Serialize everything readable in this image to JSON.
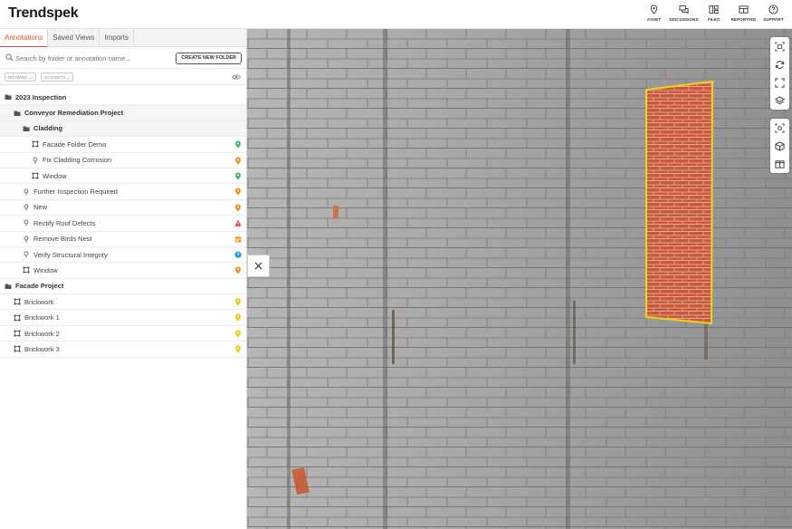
{
  "app": {
    "logo": "Trendspek"
  },
  "nav": [
    {
      "label": "ASSET",
      "icon": "map-pin-icon"
    },
    {
      "label": "DISCUSSIONS",
      "icon": "chat-icon"
    },
    {
      "label": "FILES",
      "icon": "files-icon"
    },
    {
      "label": "REPORTING",
      "icon": "report-icon"
    },
    {
      "label": "SUPPORT",
      "icon": "help-icon"
    }
  ],
  "tabs": [
    "Annotations",
    "Saved Views",
    "Imports"
  ],
  "search": {
    "placeholder": "Search by folder or annotation name..."
  },
  "create_folder_label": "CREATE NEW FOLDER",
  "filters": {
    "drawing": "DRAWING",
    "datasets": "DATASETS"
  },
  "tree": [
    {
      "label": "2023 Inspection",
      "type": "folder",
      "status": ""
    },
    {
      "label": "Conveyor Remediation Project",
      "type": "folder",
      "status": ""
    },
    {
      "label": "Cladding",
      "type": "folder",
      "status": ""
    },
    {
      "label": "Facade Folder Demo",
      "type": "area",
      "status": "green"
    },
    {
      "label": "Fix Cladding Corrosion",
      "type": "pin",
      "status": "orange"
    },
    {
      "label": "Window",
      "type": "area",
      "status": "green"
    },
    {
      "label": "Further Inspection Required",
      "type": "pin",
      "status": "orange"
    },
    {
      "label": "New",
      "type": "pin",
      "status": "orange"
    },
    {
      "label": "Rectify Roof Defects",
      "type": "pin",
      "status": "red-warning"
    },
    {
      "label": "Remove Birds Nest",
      "type": "pin",
      "status": "orange-calendar"
    },
    {
      "label": "Verify Structural Integrity",
      "type": "pin",
      "status": "blue-help"
    },
    {
      "label": "Window",
      "type": "area",
      "status": "orange"
    },
    {
      "label": "Facade Project",
      "type": "folder",
      "status": ""
    },
    {
      "label": "Brickwork",
      "type": "area",
      "status": "yellow"
    },
    {
      "label": "Brickwork 1",
      "type": "area",
      "status": "yellow"
    },
    {
      "label": "Brickwork 2",
      "type": "area",
      "status": "yellow"
    },
    {
      "label": "Brickwork 3",
      "type": "area",
      "status": "yellow"
    }
  ],
  "colors": {
    "accent": "#e0502a",
    "green": "#3cb878",
    "orange": "#f28c28",
    "red": "#e53935",
    "blue": "#1e9bd7",
    "yellow": "#f5c518",
    "highlight": "#f2d21b"
  },
  "toolbar_icons": [
    "screenshot-icon",
    "refresh-icon",
    "fullscreen-icon",
    "layers-icon",
    "focus-icon",
    "cube-icon",
    "split-view-icon"
  ]
}
